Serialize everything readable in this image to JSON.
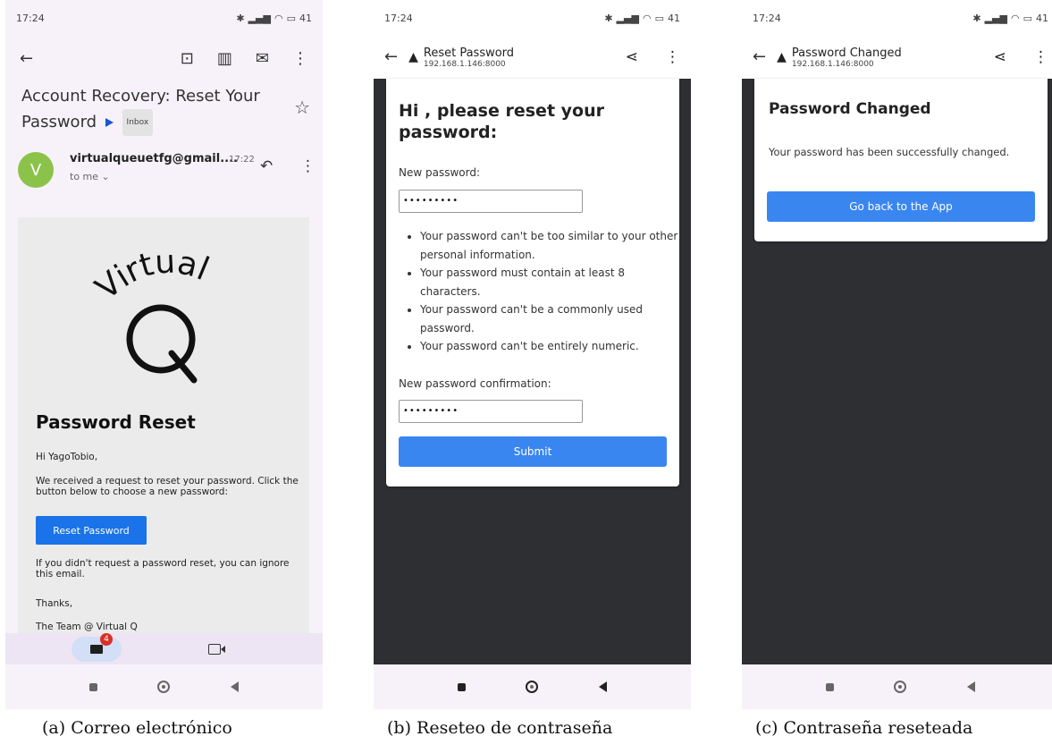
{
  "status_bar": {
    "time": "17:24",
    "email_time": "17:24",
    "battery": "41"
  },
  "email": {
    "subject": "Account Recovery: Reset Your Password",
    "subject_part1": "Account Recovery: Reset Your",
    "subject_part2": "Password",
    "label_badge": "Inbox",
    "sender_initial": "V",
    "sender": "virtualqueuetfg@gmail....",
    "time": "17:22",
    "recipient": "to me",
    "logo_text": "Virtual",
    "logo_letter": "Q",
    "heading": "Password Reset",
    "greeting": "Hi YagoTobio,",
    "body": "We received a request to reset your password. Click the button below to choose a new password:",
    "button": "Reset Password",
    "ignore": "If you didn't request a password reset, you can ignore this email.",
    "thanks": "Thanks,",
    "signature": "The Team @ Virtual Q",
    "notification_count": "4"
  },
  "reset_page": {
    "page_title": "Reset Password",
    "url": "192.168.1.146:8000",
    "heading": "Hi , please reset your password:",
    "new_password_label": "New password:",
    "new_password_value": "•••••••••",
    "rules": [
      "Your password can't be too similar to your other personal information.",
      "Your password must contain at least 8 characters.",
      "Your password can't be a commonly used password.",
      "Your password can't be entirely numeric."
    ],
    "confirm_label": "New password confirmation:",
    "confirm_value": "•••••••••",
    "submit": "Submit"
  },
  "changed_page": {
    "page_title": "Password Changed",
    "url": "192.168.1.146:8000",
    "heading": "Password Changed",
    "message": "Your password has been successfully changed.",
    "button": "Go back to the App"
  },
  "captions": {
    "a": "(a) Correo electrónico",
    "b": "(b) Reseteo de contraseña",
    "c": "(c) Contraseña reseteada"
  },
  "colors": {
    "primary_button": "#3a86f0",
    "gmail_button": "#1a73e8",
    "avatar": "#8bc34a",
    "page_bg": "#2d2f33"
  }
}
